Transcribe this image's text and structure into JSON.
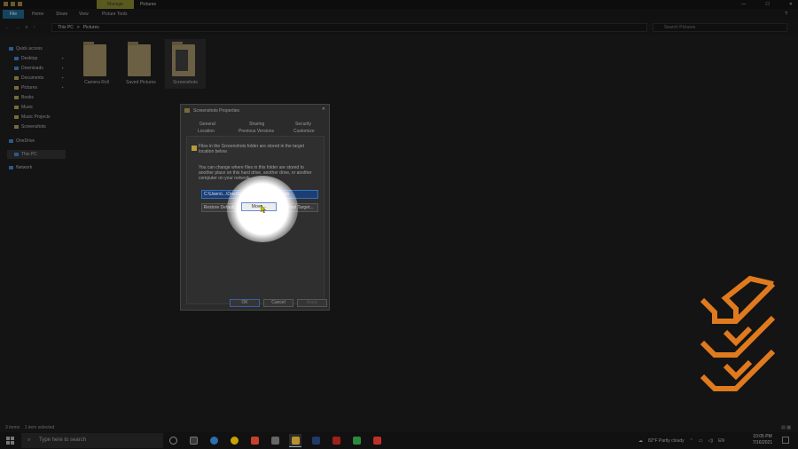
{
  "window": {
    "context_tab": "Manage",
    "title": "Pictures",
    "controls": [
      "—",
      "☐",
      "✕"
    ]
  },
  "ribbon": {
    "tabs": [
      "File",
      "Home",
      "Share",
      "View",
      "Picture Tools"
    ],
    "help": "?"
  },
  "address": {
    "nav": [
      "←",
      "→",
      "∨",
      "↑"
    ],
    "path": [
      "This PC",
      ">",
      "Pictures"
    ],
    "search_placeholder": "Search Pictures"
  },
  "sidebar": {
    "quick_access": "Quick access",
    "items": [
      "Desktop",
      "Downloads",
      "Documents",
      "Pictures",
      "Books",
      "Music",
      "Music Projects",
      "Screenshots"
    ],
    "onedrive": "OneDrive",
    "this_pc": "This PC",
    "network": "Network"
  },
  "folders": [
    {
      "label": "Camera Roll"
    },
    {
      "label": "Saved Pictures"
    },
    {
      "label": "Screenshots"
    }
  ],
  "status": {
    "items": "3 items",
    "selected": "1 item selected",
    "views": "▤ ▦"
  },
  "dialog": {
    "title": "Screenshots Properties",
    "close": "✕",
    "tabs_row1": [
      "General",
      "Sharing",
      "Security"
    ],
    "tabs_row2": [
      "Location",
      "Previous Versions",
      "Customize"
    ],
    "info": "Files in the Screenshots folder are stored in the target location below.",
    "desc": "You can change where files in this folder are stored to another place on this hard drive, another drive, or another computer on your network.",
    "path_value": "C:\\Users\\...\\OneDrive\\Pictures\\Screenshots",
    "restore_label": "Restore Default",
    "move_label": "Move...",
    "find_label": "Find Target...",
    "ok_label": "OK",
    "cancel_label": "Cancel",
    "apply_label": "Apply"
  },
  "taskbar": {
    "search_placeholder": "Type here to search",
    "weather": "82°F  Partly cloudy",
    "time": "10:05 PM",
    "date": "7/16/2021",
    "colors": {
      "app1": "#3a3a3a",
      "app2": "#2b6fb0",
      "app3": "#c8a200",
      "app4": "#c4412b",
      "app5": "#666666",
      "app6": "#b7922d",
      "app7": "#1f3a66",
      "app8": "#a0201a",
      "app9": "#2c8a3c",
      "app10": "#c03028"
    }
  },
  "accent": {
    "logo": "#e07a1e",
    "selection": "#1c3f73"
  }
}
